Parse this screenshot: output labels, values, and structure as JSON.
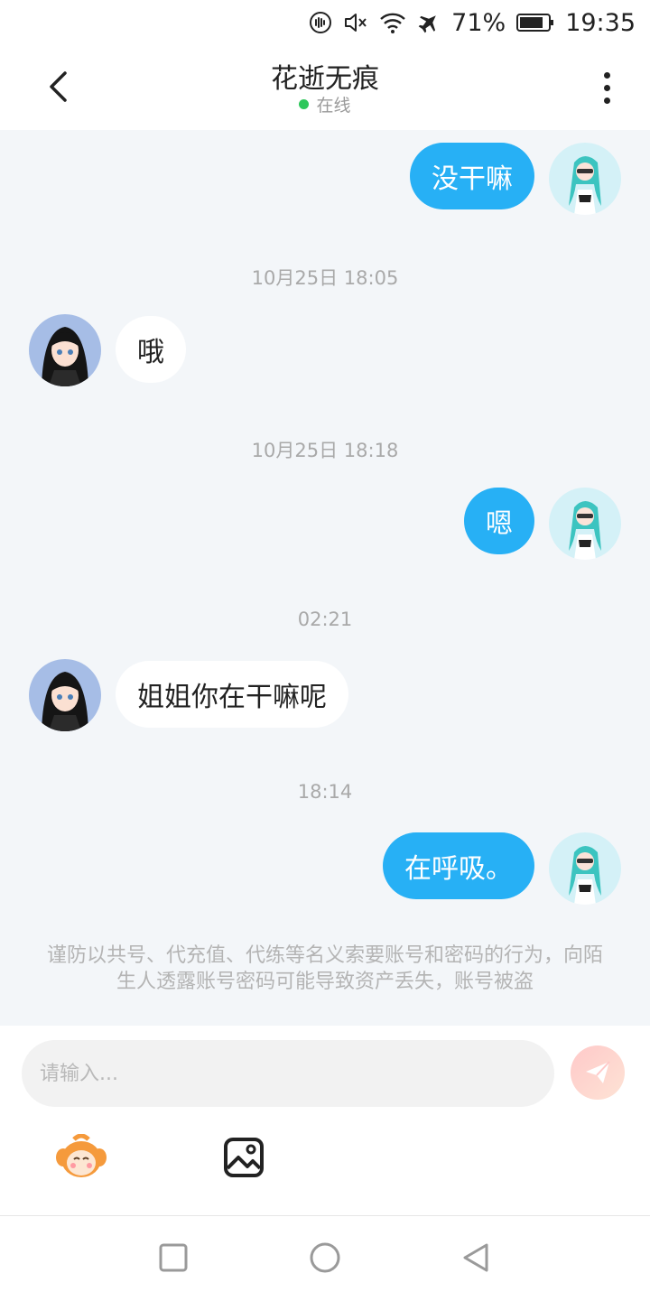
{
  "status_bar": {
    "battery": "71%",
    "time": "19:35"
  },
  "header": {
    "title": "花逝无痕",
    "status": "在线",
    "status_color": "#2ec75b"
  },
  "messages": [
    {
      "from": "me",
      "text": "没干嘛"
    },
    {
      "timestamp": "10月25日 18:05"
    },
    {
      "from": "them",
      "text": "哦"
    },
    {
      "timestamp": "10月25日 18:18"
    },
    {
      "from": "me",
      "text": "嗯"
    },
    {
      "timestamp": "02:21"
    },
    {
      "from": "them",
      "text": "姐姐你在干嘛呢"
    },
    {
      "timestamp": "18:14"
    },
    {
      "from": "me",
      "text": "在呼吸。"
    }
  ],
  "notice": {
    "text": "谨防以共号、代充值、代练等名义索要账号和密码的行为，向陌生人透露账号密码可能导致资产丢失，账号被盗"
  },
  "input": {
    "placeholder": "请输入...",
    "value": ""
  },
  "toolbar": {
    "icons": [
      "emoji-mascot-icon",
      "image-icon"
    ]
  },
  "colors": {
    "accent": "#27b0f5",
    "chat_background": "#f3f6f9",
    "send_button": "#ffc9c9"
  }
}
